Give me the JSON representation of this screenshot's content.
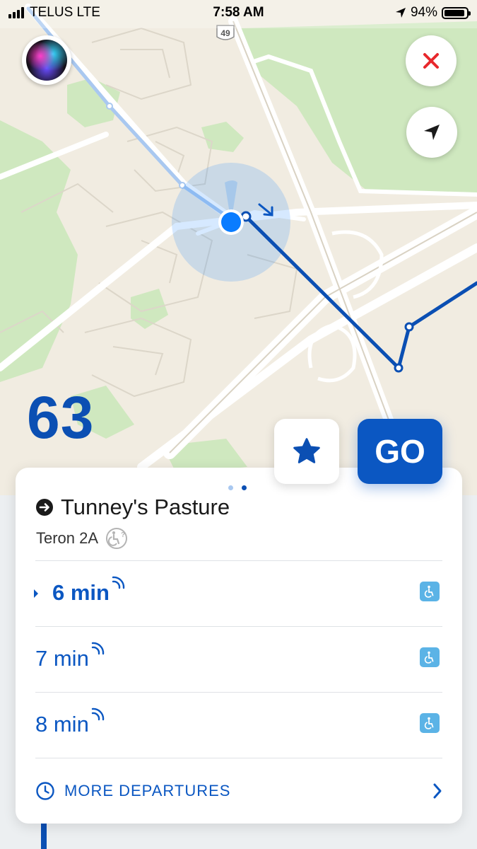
{
  "status_bar": {
    "carrier": "TELUS LTE",
    "time": "7:58 AM",
    "battery_percent": "94%",
    "battery_level": 0.94
  },
  "map": {
    "highway_shield": "49",
    "colors": {
      "land": "#f1ece1",
      "park": "#cfe8bf",
      "road": "#ffffff",
      "route": "#0b4fb3",
      "walk_path": "#a9c8f0",
      "location": "#0a7cff"
    }
  },
  "controls": {
    "siri_icon": "siri-icon",
    "close_icon": "close-x-icon",
    "locate_icon": "location-arrow-icon"
  },
  "route": {
    "number": "63",
    "favorite_icon": "star-icon",
    "go_label": "GO"
  },
  "sheet": {
    "page_dots": 2,
    "active_page": 2,
    "destination": "Tunney's Pasture",
    "stop": "Teron 2A",
    "departures": [
      {
        "time": "6 min",
        "selected": true
      },
      {
        "time": "7 min",
        "selected": false
      },
      {
        "time": "8 min",
        "selected": false
      }
    ],
    "more_label": "MORE DEPARTURES"
  }
}
